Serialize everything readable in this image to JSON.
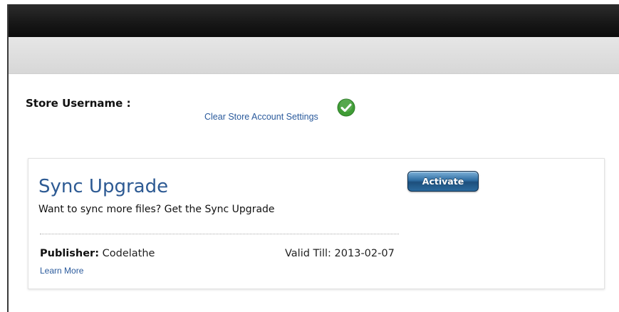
{
  "store": {
    "username_label": "Store Username :",
    "clear_link": "Clear Store Account Settings",
    "status_icon": "check-circle-icon",
    "status_color": "#3f9c35"
  },
  "card": {
    "title": "Sync Upgrade",
    "description": "Want to sync more files? Get the Sync Upgrade",
    "activate_label": "Activate",
    "publisher_label": "Publisher:",
    "publisher_value": "Codelathe",
    "valid_label": "Valid Till:",
    "valid_value": "2013-02-07",
    "learn_more": "Learn More"
  },
  "colors": {
    "header_dark": "#161616",
    "subheader": "#dcdcdc",
    "link": "#2a5a9c",
    "title": "#2d5a93",
    "button": "#2f6ea3"
  }
}
